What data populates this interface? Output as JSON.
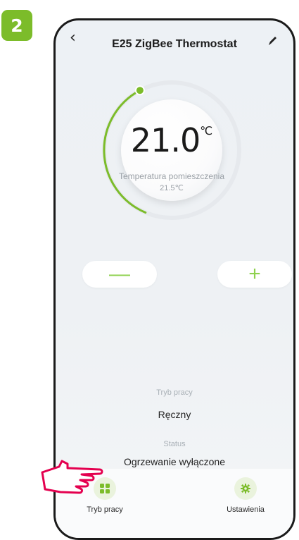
{
  "step": {
    "number": "2"
  },
  "header": {
    "title": "E25 ZigBee Thermostat",
    "back_icon": "chevron-left-icon",
    "edit_icon": "pencil-icon"
  },
  "dial": {
    "setpoint": "21.0",
    "unit": "℃",
    "room_label": "Temperatura pomieszczenia",
    "room_value": "21.5℃",
    "progress_fraction": 0.22
  },
  "controls": {
    "minus_label": "—",
    "plus_label": "+"
  },
  "info": {
    "mode_label": "Tryb pracy",
    "mode_value": "Ręczny",
    "status_label": "Status",
    "status_value": "Ogrzewanie wyłączone"
  },
  "bottom_nav": {
    "items": [
      {
        "label": "Tryb pracy",
        "icon": "grid-icon"
      },
      {
        "label": "Ustawienia",
        "icon": "gear-icon"
      }
    ]
  },
  "colors": {
    "accent": "#7cbc2a",
    "accent_light": "#8ed14e",
    "badge": "#7cbc2a"
  }
}
